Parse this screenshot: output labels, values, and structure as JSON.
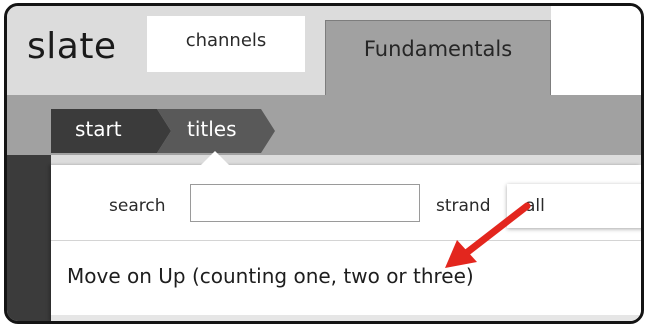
{
  "app": {
    "logo": "slate"
  },
  "tabs": [
    {
      "label": "channels",
      "active": false
    },
    {
      "label": "Fundamentals",
      "active": true
    }
  ],
  "breadcrumb": [
    {
      "label": "start"
    },
    {
      "label": "titles"
    }
  ],
  "search": {
    "label": "search",
    "value": "",
    "placeholder": ""
  },
  "strand": {
    "label": "strand",
    "selected": "all"
  },
  "results": [
    {
      "title": "Move on Up (counting one, two or three)"
    }
  ],
  "annotation": {
    "icon": "red-arrow-icon",
    "color": "#e3261e"
  },
  "colors": {
    "tab_active": "#a1a1a1",
    "crumb_start": "#3b3b3b",
    "crumb_titles": "#595959"
  }
}
